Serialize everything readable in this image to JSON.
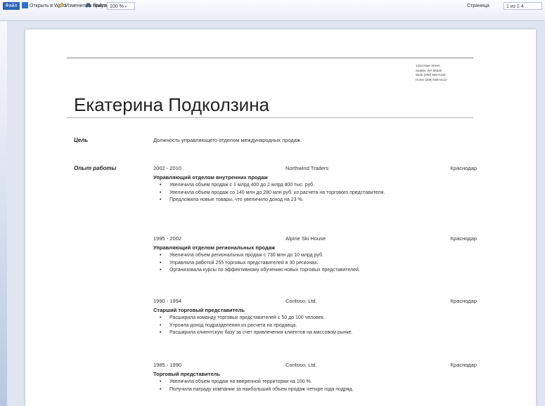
{
  "toolbar": {
    "file": "Файл",
    "open_word": "Открыть в Word",
    "edit_browser": "Изменить в браузере",
    "find": "Найти",
    "zoom": "100 %",
    "page_label": "Страница",
    "page_value": "1 из 1 4"
  },
  "resume": {
    "address": [
      "1234 Main Street",
      "Seattle, WA 55525",
      "Work (206) 555-0130",
      "Home (206) 555-0123"
    ],
    "name": "Екатерина Подколзина",
    "objective_label": "Цель",
    "objective_text": "Должность управляющего отделом международных продаж.",
    "experience_label": "Опыт работы",
    "jobs": [
      {
        "years": "2002 - 2010",
        "company": "Northwind Traders",
        "city": "Краснодар",
        "title": "Управляющий отделом внутренних продаж",
        "bullets": [
          "Увеличила объем продаж с 1 млрд 400 до 2 млрд 800 тыс. руб.",
          "Увеличила объем продаж со 140 млн до 280 млн руб. из расчета на торгового представителя.",
          "Предложила новые товары, что увеличило доход на 23 %."
        ]
      },
      {
        "years": "1995 - 2002",
        "company": "Alpine Ski House",
        "city": "Краснодар",
        "title": "Управляющий отделом региональных продаж",
        "bullets": [
          "Увеличила объем региональных продаж с 730 млн до 10 млрд руб.",
          "Управляла работой 255 торговых представителей в 30 регионах.",
          "Организовала курсы по эффективному обучению новых торговых представителей."
        ]
      },
      {
        "years": "1990 - 1994",
        "company": "Contoso, Ltd.",
        "city": "Краснодар",
        "title": "Старший торговый представитель",
        "bullets": [
          "Расширила команду торговых представителей с 50 до 100 человек.",
          "Утроила доход подразделения из расчета на продавца.",
          "Расширила клиентскую базу за счет привлечения клиентов на массовом рынке."
        ]
      },
      {
        "years": "1985 - 1990",
        "company": "Contoso, Ltd.",
        "city": "Краснодар",
        "title": "Торговый представитель",
        "bullets": [
          "Увеличила объем продаж на вверенной территории на 100 %.",
          "Получила награду компании за наибольший объем продаж четыре года подряд."
        ]
      }
    ]
  }
}
